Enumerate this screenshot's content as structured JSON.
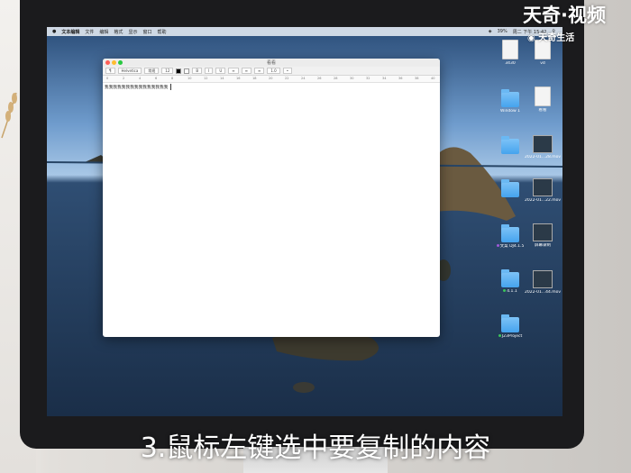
{
  "watermark": {
    "brand": "天奇·视频",
    "sub": "天奇生活"
  },
  "caption": "3.鼠标左键选中要复制的内容",
  "menubar": {
    "apple": "",
    "items": [
      "文本编辑",
      "文件",
      "编辑",
      "格式",
      "显示",
      "窗口",
      "帮助"
    ],
    "status": [
      "39%",
      "周二 下午 15:42"
    ]
  },
  "textedit": {
    "title": "看看",
    "font_style": "Helvetica",
    "font_weight": "常规",
    "font_size": "12",
    "bold": "B",
    "italic": "I",
    "underline": "U",
    "line_spacing": "1.0",
    "ruler_ticks": [
      "0",
      "2",
      "4",
      "6",
      "8",
      "10",
      "12",
      "14",
      "16",
      "18",
      "20",
      "22",
      "24",
      "26",
      "28",
      "30",
      "32",
      "34",
      "36",
      "38",
      "40"
    ],
    "content": "我我我我我我我我我我我我我我我"
  },
  "desktop_icons": [
    {
      "name": "3430",
      "type": "doc"
    },
    {
      "name": "vd",
      "type": "doc"
    },
    {
      "name": "Window 1",
      "type": "folder"
    },
    {
      "name": "看看",
      "type": "doc"
    },
    {
      "name": "",
      "type": "folder"
    },
    {
      "name": "2022-01...28.mov",
      "type": "video"
    },
    {
      "name": "",
      "type": "folder"
    },
    {
      "name": "2022-01...22.mov",
      "type": "video"
    },
    {
      "name": "文案 DJ4.1.5",
      "type": "folder"
    },
    {
      "name": "屏幕录制",
      "type": "video"
    },
    {
      "name": "4.1.1",
      "type": "folder"
    },
    {
      "name": "2022-01...44.mov",
      "type": "video"
    },
    {
      "name": "J23Project",
      "type": "folder"
    }
  ],
  "colors": {
    "folder": "#45a3ee",
    "menubar": "#e1e8f0",
    "window": "#ffffff"
  }
}
